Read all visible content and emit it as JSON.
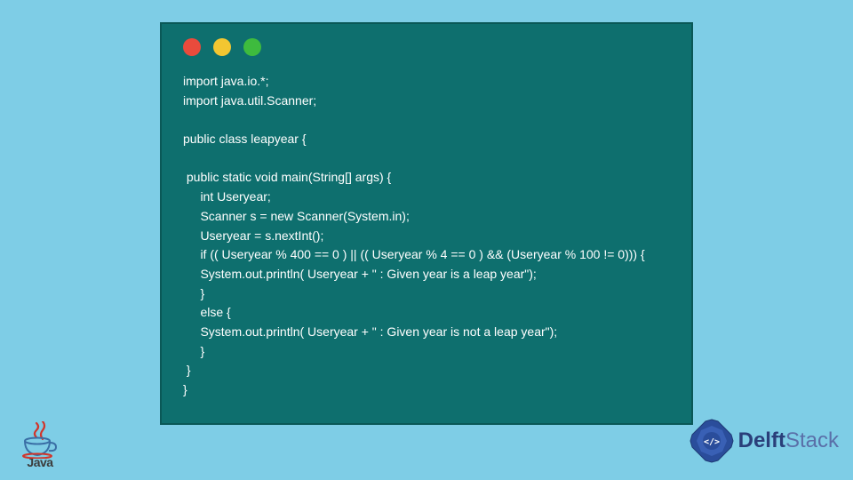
{
  "window": {
    "dots": [
      "red",
      "yellow",
      "green"
    ]
  },
  "code": {
    "text": "import java.io.*;\nimport java.util.Scanner;\n\npublic class leapyear {\n\n public static void main(String[] args) {\n     int Useryear;\n     Scanner s = new Scanner(System.in);\n     Useryear = s.nextInt();\n     if (( Useryear % 400 == 0 ) || (( Useryear % 4 == 0 ) && (Useryear % 100 != 0))) {\n     System.out.println( Useryear + \" : Given year is a leap year\");\n     }\n     else {\n     System.out.println( Useryear + \" : Given year is not a leap year\");\n     }\n }\n}"
  },
  "logos": {
    "java_label": "Java",
    "delft_label_a": "Delft",
    "delft_label_b": "Stack"
  }
}
